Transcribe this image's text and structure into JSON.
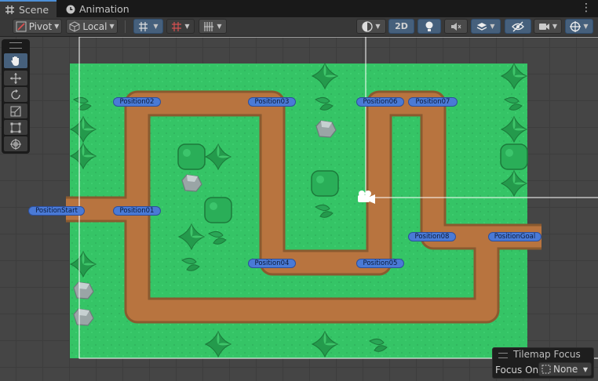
{
  "tabs": [
    {
      "label": "Scene",
      "icon": "hash-icon",
      "active": true
    },
    {
      "label": "Animation",
      "icon": "clock-icon",
      "active": false
    }
  ],
  "toolbar": {
    "pivot_label": "Pivot",
    "local_label": "Local",
    "mode_2d_label": "2D"
  },
  "tools": [
    {
      "name": "hand-tool",
      "active": true
    },
    {
      "name": "move-tool",
      "active": false
    },
    {
      "name": "rotate-tool",
      "active": false
    },
    {
      "name": "scale-tool",
      "active": false
    },
    {
      "name": "rect-tool",
      "active": false
    },
    {
      "name": "transform-tool",
      "active": false
    }
  ],
  "waypoints": [
    {
      "label": "Position02"
    },
    {
      "label": "Position03"
    },
    {
      "label": "Position06"
    },
    {
      "label": "Position07"
    },
    {
      "label": "PositionStart"
    },
    {
      "label": "Position01"
    },
    {
      "label": "Position08"
    },
    {
      "label": "PositionGoal"
    },
    {
      "label": "Position04"
    },
    {
      "label": "Position05"
    }
  ],
  "tilemap_focus": {
    "title": "Tilemap Focus",
    "focus_on_label": "Focus On",
    "value": "None"
  },
  "colors": {
    "grass": "#35c466",
    "path": "#b8743f",
    "label_fill": "#4a7ad6",
    "accent_blue": "#46607c"
  }
}
